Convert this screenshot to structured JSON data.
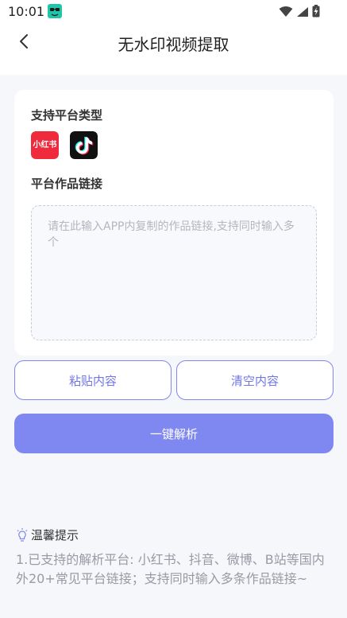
{
  "status_bar": {
    "time": "10:01",
    "icons": [
      "app-notification-icon",
      "wifi-icon",
      "signal-icon",
      "battery-charging-icon"
    ]
  },
  "header": {
    "title": "无水印视频提取",
    "back_icon": "chevron-left-icon"
  },
  "platforms": {
    "label": "支持平台类型",
    "items": [
      {
        "name": "小红书",
        "icon_text": "小红书",
        "color": "#ee2a3c"
      },
      {
        "name": "tiktok",
        "icon": "tiktok-icon",
        "color": "#111111"
      }
    ]
  },
  "link_section": {
    "label": "平台作品链接",
    "placeholder": "请在此输入APP内复制的作品链接,支持同时输入多个",
    "value": ""
  },
  "buttons": {
    "paste": "粘贴内容",
    "clear": "清空内容",
    "parse": "一键解析"
  },
  "tips": {
    "icon": "lightbulb-icon",
    "title": "温馨提示",
    "text": "1.已支持的解析平台: 小红书、抖音、微博、B站等国内外20+常见平台链接；支持同时输入多条作品链接~"
  },
  "colors": {
    "accent": "#7f88f0",
    "accent_text": "#6f77e6",
    "background": "#f6f7fb"
  }
}
